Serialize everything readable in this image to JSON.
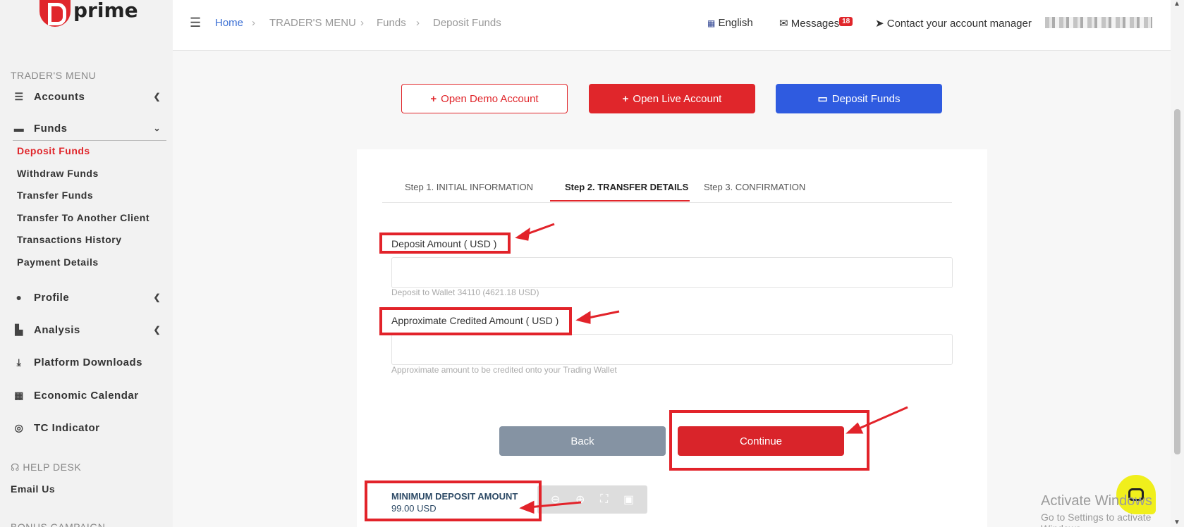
{
  "brand": {
    "name": "prime"
  },
  "sidebar": {
    "section_traders_menu": "TRADER'S MENU",
    "items": [
      {
        "label": "Accounts"
      },
      {
        "label": "Funds"
      },
      {
        "label": "Profile"
      },
      {
        "label": "Analysis"
      },
      {
        "label": "Platform Downloads"
      },
      {
        "label": "Economic Calendar"
      },
      {
        "label": "TC Indicator"
      }
    ],
    "funds_sub": [
      {
        "label": "Deposit Funds"
      },
      {
        "label": "Withdraw Funds"
      },
      {
        "label": "Transfer Funds"
      },
      {
        "label": "Transfer To Another Client"
      },
      {
        "label": "Transactions History"
      },
      {
        "label": "Payment Details"
      }
    ],
    "section_help_desk": "HELP DESK",
    "email_us": "Email Us",
    "bonus_campaign": "BONUS CAMPAIGN"
  },
  "topbar": {
    "breadcrumb": [
      "Home",
      "TRADER'S MENU",
      "Funds",
      "Deposit Funds"
    ],
    "language": "English",
    "messages": "Messages",
    "messages_count": "18",
    "contact": "Contact your account manager"
  },
  "actions": {
    "open_demo": "Open Demo Account",
    "open_live": "Open Live Account",
    "deposit": "Deposit Funds"
  },
  "steps": [
    "Step 1. INITIAL INFORMATION",
    "Step 2. TRANSFER DETAILS",
    "Step 3. CONFIRMATION"
  ],
  "form": {
    "deposit_label": "Deposit Amount ( USD )",
    "deposit_value": "",
    "deposit_hint": "Deposit to Wallet 34110 (4621.18 USD)",
    "credited_label": "Approximate Credited Amount ( USD )",
    "credited_value": "",
    "credited_hint": "Approximate amount to be credited onto your Trading Wallet",
    "back": "Back",
    "continue": "Continue",
    "min_title": "MINIMUM DEPOSIT AMOUNT",
    "min_value": "99.00 USD"
  },
  "overlay": {
    "watermark_title": "Activate Windows",
    "watermark_sub": "Go to Settings to activate Windows."
  },
  "colors": {
    "brand_red": "#e0262b",
    "deposit_blue": "#2f5be0",
    "back_gray": "#8593a3",
    "annotation_red": "#e2232a"
  }
}
